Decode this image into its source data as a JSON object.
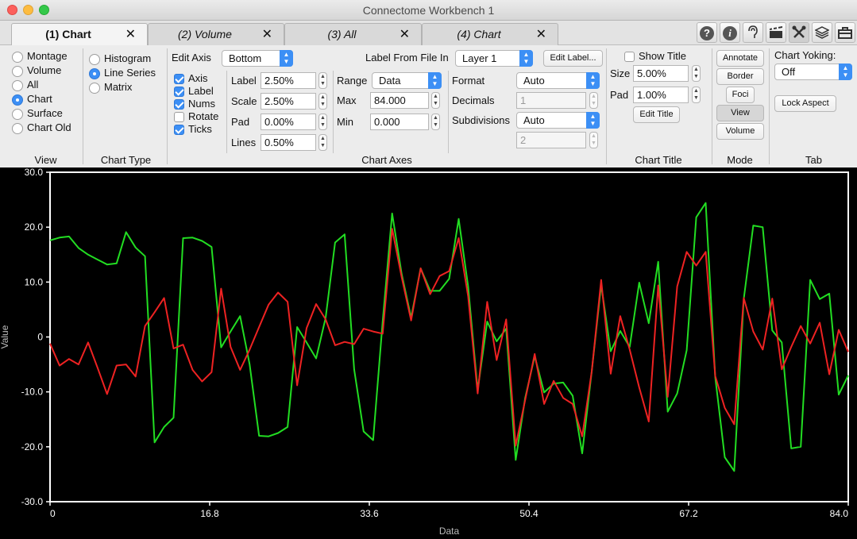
{
  "window": {
    "title": "Connectome Workbench 1"
  },
  "tabs": [
    {
      "label": "(1) Chart",
      "active": true
    },
    {
      "label": "(2) Volume",
      "active": false
    },
    {
      "label": "(3) All",
      "active": false
    },
    {
      "label": "(4) Chart",
      "active": false
    }
  ],
  "tab_close_glyph": "✕",
  "toolbar_icons": [
    "help-icon",
    "info-icon",
    "identify-icon",
    "movie-icon",
    "tools-icon",
    "layers-icon",
    "toolbox-icon"
  ],
  "view": {
    "label": "View",
    "options": [
      "Montage",
      "Volume",
      "All",
      "Chart",
      "Surface",
      "Chart Old"
    ],
    "selected": "Chart"
  },
  "chart_type": {
    "label": "Chart Type",
    "options": [
      "Histogram",
      "Line Series",
      "Matrix"
    ],
    "selected": "Line Series"
  },
  "chart_axes": {
    "label": "Chart Axes",
    "edit_axis_label": "Edit Axis",
    "edit_axis_value": "Bottom",
    "checks": [
      {
        "label": "Axis",
        "checked": true
      },
      {
        "label": "Label",
        "checked": true
      },
      {
        "label": "Nums",
        "checked": true
      },
      {
        "label": "Rotate",
        "checked": false
      },
      {
        "label": "Ticks",
        "checked": true
      }
    ],
    "size_fields": [
      {
        "label": "Label",
        "value": "2.50%"
      },
      {
        "label": "Scale",
        "value": "2.50%"
      },
      {
        "label": "Pad",
        "value": "0.00%"
      },
      {
        "label": "Lines",
        "value": "0.50%"
      }
    ],
    "label_from_file_label": "Label From File In",
    "label_from_file_value": "Layer 1",
    "edit_label_button": "Edit Label...",
    "range_label": "Range",
    "range_value": "Data",
    "max_label": "Max",
    "max_value": "84.000",
    "min_label": "Min",
    "min_value": "0.000",
    "format_label": "Format",
    "format_value": "Auto",
    "decimals_label": "Decimals",
    "decimals_value": "1",
    "subdivisions_label": "Subdivisions",
    "subdivisions_value": "Auto",
    "subdivisions_count": "2"
  },
  "chart_title": {
    "label": "Chart Title",
    "show_title_label": "Show Title",
    "show_title_checked": false,
    "size_label": "Size",
    "size_value": "5.00%",
    "pad_label": "Pad",
    "pad_value": "1.00%",
    "edit_title_button": "Edit Title"
  },
  "mode": {
    "label": "Mode",
    "buttons": [
      "Annotate",
      "Border",
      "Foci",
      "View",
      "Volume"
    ],
    "selected": "View"
  },
  "tab_group": {
    "label": "Tab",
    "chart_yoking_label": "Chart Yoking:",
    "chart_yoking_value": "Off",
    "lock_aspect_button": "Lock Aspect"
  },
  "chart_data": {
    "type": "line",
    "xlabel": "Data",
    "ylabel": "Value",
    "xlim": [
      0,
      84
    ],
    "ylim": [
      -30,
      30
    ],
    "x_ticks": [
      "0",
      "16.8",
      "33.6",
      "50.4",
      "67.2",
      "84.0"
    ],
    "y_ticks": [
      "30.0",
      "20.0",
      "10.0",
      "0",
      "-10.0",
      "-20.0",
      "-30.0"
    ],
    "background": "#000000",
    "axis_color": "#ffffff",
    "series": [
      {
        "color": "#22dd22",
        "values": [
          17.6,
          18.1,
          18.3,
          16.2,
          15,
          14.1,
          13.2,
          13.4,
          19.1,
          16.3,
          14.7,
          -19.2,
          -16.4,
          -14.7,
          18,
          18.1,
          17.5,
          16.4,
          -1.9,
          1,
          3.8,
          -5,
          -18,
          -18.1,
          -17.5,
          -16.4,
          1.8,
          -1,
          -3.9,
          3.5,
          17.2,
          18.7,
          -5.9,
          -17.2,
          -18.8,
          2.8,
          22.5,
          11.5,
          3.5,
          12.5,
          8.4,
          8.4,
          10.6,
          21.5,
          9.2,
          -9.7,
          2.8,
          -0.8,
          1.5,
          -22.4,
          -11.1,
          -3.5,
          -10.1,
          -8.5,
          -8.3,
          -10.7,
          -21.2,
          -6.3,
          9.5,
          -2.6,
          1.1,
          -1.8,
          9.9,
          2.5,
          13.7,
          -13.6,
          -10.3,
          -2.4,
          21.8,
          24.4,
          -7.3,
          -21.9,
          -24.4,
          6.9,
          20.3,
          20,
          1.2,
          -1,
          -20.3,
          -20,
          10.4,
          6.9,
          7.9,
          -10.5,
          -7
        ]
      },
      {
        "color": "#ee2222",
        "values": [
          -1.2,
          -5.2,
          -4,
          -5,
          -1,
          -5.6,
          -10.4,
          -5.2,
          -5,
          -7.2,
          2,
          4.5,
          7.1,
          -2.1,
          -1.4,
          -6,
          -8.1,
          -6.4,
          8.8,
          -1.8,
          -6,
          -2.3,
          1.8,
          5.9,
          8.1,
          6.4,
          -8.8,
          1.6,
          6,
          3.2,
          -1.5,
          -0.9,
          -1.3,
          1.5,
          1,
          0.6,
          19.7,
          10.9,
          3,
          12.5,
          7.8,
          11.1,
          12,
          18,
          7.4,
          -10.3,
          6.4,
          -4.2,
          3.2,
          -19.8,
          -11.5,
          -3.1,
          -12.2,
          -8,
          -11.1,
          -12.2,
          -18.1,
          -6.3,
          10.4,
          -6.7,
          3.8,
          -2.3,
          -9.2,
          -15.4,
          9.4,
          -10.9,
          9.2,
          15.5,
          13,
          15.5,
          -7.1,
          -12.9,
          -15.9,
          7.1,
          1,
          -2.3,
          7,
          -5.9,
          -1.8,
          2,
          -1.2,
          2.6,
          -6.8,
          1.3,
          -2.7
        ]
      }
    ]
  }
}
